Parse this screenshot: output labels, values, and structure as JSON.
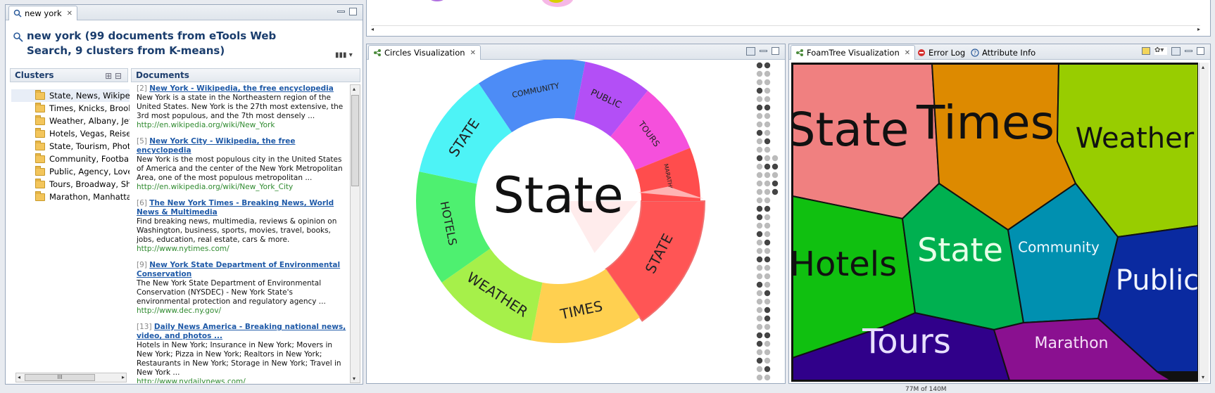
{
  "left_panel": {
    "tab_label": "new york",
    "title": "new york (99 documents from eTools Web Search, 9 clusters from K-means)",
    "clusters_header": "Clusters",
    "documents_header": "Documents",
    "clusters": [
      "State, News, Wikipedi",
      "Times, Knicks, Brookl",
      "Weather, Albany, Jets",
      "Hotels, Vegas, Reisen",
      "State, Tourism, Photc",
      "Community, Football",
      "Public, Agency, Love",
      "Tours, Broadway, Shc",
      "Marathon, Manhattar"
    ],
    "scroll_thumb_label": "III",
    "documents": [
      {
        "num": "[2]",
        "title": "New York - Wikipedia, the free encyclopedia",
        "snippet": "New York is a state in the Northeastern region of the United States. New York is the 27th most extensive, the 3rd most populous, and the 7th most densely ...",
        "url": "http://en.wikipedia.org/wiki/New_York"
      },
      {
        "num": "[5]",
        "title": "New York City - Wikipedia, the free encyclopedia",
        "snippet": "New York is the most populous city in the United States of America and the center of the New York Metropolitan Area, one of the most populous metropolitan ...",
        "url": "http://en.wikipedia.org/wiki/New_York_City"
      },
      {
        "num": "[6]",
        "title": "The New York Times - Breaking News, World News & Multimedia",
        "snippet": "Find breaking news, multimedia, reviews & opinion on Washington, business, sports, movies, travel, books, jobs, education, real estate, cars & more.",
        "url": "http://www.nytimes.com/"
      },
      {
        "num": "[9]",
        "title": "New York State Department of Environmental Conservation",
        "snippet": "The New York State Department of Environmental Conservation (NYSDEC) - New York State's environmental protection and regulatory agency ...",
        "url": "http://www.dec.ny.gov/"
      },
      {
        "num": "[13]",
        "title": "Daily News America - Breaking national news, video, and photos ...",
        "snippet": "Hotels in New York; Insurance in New York; Movers in New York; Pizza in New York; Realtors in New York; Restaurants in New York; Storage in New York; Travel in New York ...",
        "url": "http://www.nydailynews.com/"
      }
    ]
  },
  "circles_view": {
    "tab_label": "Circles Visualization",
    "center_label": "State",
    "segments": [
      {
        "label": "STATE",
        "color": "#ff5555"
      },
      {
        "label": "TIMES",
        "color": "#ffd050"
      },
      {
        "label": "WEATHER",
        "color": "#a6f04a"
      },
      {
        "label": "HOTELS",
        "color": "#4ef070"
      },
      {
        "label": "STATE",
        "color": "#4df3f6"
      },
      {
        "label": "COMMUNITY",
        "color": "#4d8cf6"
      },
      {
        "label": "PUBLIC",
        "color": "#b34ff6"
      },
      {
        "label": "TOURS",
        "color": "#f550dc"
      },
      {
        "label": "MARATHON",
        "color": "#ff4d4d"
      }
    ]
  },
  "foam_view": {
    "tabs": [
      "FoamTree Visualization",
      "Error Log",
      "Attribute Info"
    ],
    "cells": [
      {
        "label": "State",
        "color": "#f08080"
      },
      {
        "label": "Times",
        "color": "#dd8a00"
      },
      {
        "label": "Weather",
        "color": "#98cd00"
      },
      {
        "label": "Hotels",
        "color": "#10c010"
      },
      {
        "label": "State",
        "color": "#00b050"
      },
      {
        "label": "Community",
        "color": "#0090b0"
      },
      {
        "label": "Public",
        "color": "#0a2aa0"
      },
      {
        "label": "Tours",
        "color": "#30008a"
      },
      {
        "label": "Marathon",
        "color": "#8a1090"
      }
    ]
  },
  "status_bar": {
    "memory": "77M of 140M"
  }
}
